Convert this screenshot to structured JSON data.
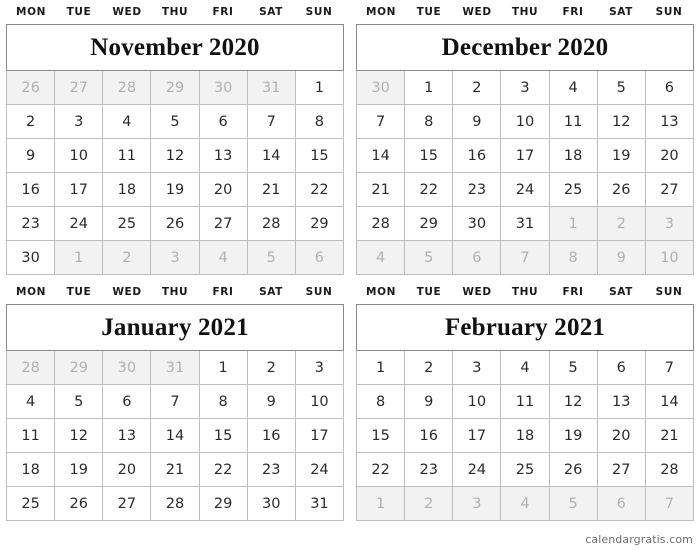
{
  "weekday_headers": [
    "MON",
    "TUE",
    "WED",
    "THU",
    "FRI",
    "SAT",
    "SUN"
  ],
  "footer": {
    "credit": "calendargratis.com"
  },
  "colors": {
    "page_background": "#ffffff",
    "cell_background": "#ffffff",
    "muted_cell_background": "#f2f2f2",
    "muted_text": "#b1b1b1",
    "text": "#2b2b2b",
    "outer_border": "#8a8a8a",
    "inner_border": "#bdbdbd",
    "footer_text": "#6d6d6d"
  },
  "calendars": [
    {
      "id": "november-2020",
      "title": "November 2020",
      "month": "November",
      "year": "2020",
      "weeks": [
        [
          {
            "d": "26",
            "muted": true
          },
          {
            "d": "27",
            "muted": true
          },
          {
            "d": "28",
            "muted": true
          },
          {
            "d": "29",
            "muted": true
          },
          {
            "d": "30",
            "muted": true
          },
          {
            "d": "31",
            "muted": true
          },
          {
            "d": "1",
            "muted": false
          }
        ],
        [
          {
            "d": "2",
            "muted": false
          },
          {
            "d": "3",
            "muted": false
          },
          {
            "d": "4",
            "muted": false
          },
          {
            "d": "5",
            "muted": false
          },
          {
            "d": "6",
            "muted": false
          },
          {
            "d": "7",
            "muted": false
          },
          {
            "d": "8",
            "muted": false
          }
        ],
        [
          {
            "d": "9",
            "muted": false
          },
          {
            "d": "10",
            "muted": false
          },
          {
            "d": "11",
            "muted": false
          },
          {
            "d": "12",
            "muted": false
          },
          {
            "d": "13",
            "muted": false
          },
          {
            "d": "14",
            "muted": false
          },
          {
            "d": "15",
            "muted": false
          }
        ],
        [
          {
            "d": "16",
            "muted": false
          },
          {
            "d": "17",
            "muted": false
          },
          {
            "d": "18",
            "muted": false
          },
          {
            "d": "19",
            "muted": false
          },
          {
            "d": "20",
            "muted": false
          },
          {
            "d": "21",
            "muted": false
          },
          {
            "d": "22",
            "muted": false
          }
        ],
        [
          {
            "d": "23",
            "muted": false
          },
          {
            "d": "24",
            "muted": false
          },
          {
            "d": "25",
            "muted": false
          },
          {
            "d": "26",
            "muted": false
          },
          {
            "d": "27",
            "muted": false
          },
          {
            "d": "28",
            "muted": false
          },
          {
            "d": "29",
            "muted": false
          }
        ],
        [
          {
            "d": "30",
            "muted": false
          },
          {
            "d": "1",
            "muted": true
          },
          {
            "d": "2",
            "muted": true
          },
          {
            "d": "3",
            "muted": true
          },
          {
            "d": "4",
            "muted": true
          },
          {
            "d": "5",
            "muted": true
          },
          {
            "d": "6",
            "muted": true
          }
        ]
      ]
    },
    {
      "id": "december-2020",
      "title": "December 2020",
      "month": "December",
      "year": "2020",
      "weeks": [
        [
          {
            "d": "30",
            "muted": true
          },
          {
            "d": "1",
            "muted": false
          },
          {
            "d": "2",
            "muted": false
          },
          {
            "d": "3",
            "muted": false
          },
          {
            "d": "4",
            "muted": false
          },
          {
            "d": "5",
            "muted": false
          },
          {
            "d": "6",
            "muted": false
          }
        ],
        [
          {
            "d": "7",
            "muted": false
          },
          {
            "d": "8",
            "muted": false
          },
          {
            "d": "9",
            "muted": false
          },
          {
            "d": "10",
            "muted": false
          },
          {
            "d": "11",
            "muted": false
          },
          {
            "d": "12",
            "muted": false
          },
          {
            "d": "13",
            "muted": false
          }
        ],
        [
          {
            "d": "14",
            "muted": false
          },
          {
            "d": "15",
            "muted": false
          },
          {
            "d": "16",
            "muted": false
          },
          {
            "d": "17",
            "muted": false
          },
          {
            "d": "18",
            "muted": false
          },
          {
            "d": "19",
            "muted": false
          },
          {
            "d": "20",
            "muted": false
          }
        ],
        [
          {
            "d": "21",
            "muted": false
          },
          {
            "d": "22",
            "muted": false
          },
          {
            "d": "23",
            "muted": false
          },
          {
            "d": "24",
            "muted": false
          },
          {
            "d": "25",
            "muted": false
          },
          {
            "d": "26",
            "muted": false
          },
          {
            "d": "27",
            "muted": false
          }
        ],
        [
          {
            "d": "28",
            "muted": false
          },
          {
            "d": "29",
            "muted": false
          },
          {
            "d": "30",
            "muted": false
          },
          {
            "d": "31",
            "muted": false
          },
          {
            "d": "1",
            "muted": true
          },
          {
            "d": "2",
            "muted": true
          },
          {
            "d": "3",
            "muted": true
          }
        ],
        [
          {
            "d": "4",
            "muted": true
          },
          {
            "d": "5",
            "muted": true
          },
          {
            "d": "6",
            "muted": true
          },
          {
            "d": "7",
            "muted": true
          },
          {
            "d": "8",
            "muted": true
          },
          {
            "d": "9",
            "muted": true
          },
          {
            "d": "10",
            "muted": true
          }
        ]
      ]
    },
    {
      "id": "january-2021",
      "title": "January 2021",
      "month": "January",
      "year": "2021",
      "weeks": [
        [
          {
            "d": "28",
            "muted": true
          },
          {
            "d": "29",
            "muted": true
          },
          {
            "d": "30",
            "muted": true
          },
          {
            "d": "31",
            "muted": true
          },
          {
            "d": "1",
            "muted": false
          },
          {
            "d": "2",
            "muted": false
          },
          {
            "d": "3",
            "muted": false
          }
        ],
        [
          {
            "d": "4",
            "muted": false
          },
          {
            "d": "5",
            "muted": false
          },
          {
            "d": "6",
            "muted": false
          },
          {
            "d": "7",
            "muted": false
          },
          {
            "d": "8",
            "muted": false
          },
          {
            "d": "9",
            "muted": false
          },
          {
            "d": "10",
            "muted": false
          }
        ],
        [
          {
            "d": "11",
            "muted": false
          },
          {
            "d": "12",
            "muted": false
          },
          {
            "d": "13",
            "muted": false
          },
          {
            "d": "14",
            "muted": false
          },
          {
            "d": "15",
            "muted": false
          },
          {
            "d": "16",
            "muted": false
          },
          {
            "d": "17",
            "muted": false
          }
        ],
        [
          {
            "d": "18",
            "muted": false
          },
          {
            "d": "19",
            "muted": false
          },
          {
            "d": "20",
            "muted": false
          },
          {
            "d": "21",
            "muted": false
          },
          {
            "d": "22",
            "muted": false
          },
          {
            "d": "23",
            "muted": false
          },
          {
            "d": "24",
            "muted": false
          }
        ],
        [
          {
            "d": "25",
            "muted": false
          },
          {
            "d": "26",
            "muted": false
          },
          {
            "d": "27",
            "muted": false
          },
          {
            "d": "28",
            "muted": false
          },
          {
            "d": "29",
            "muted": false
          },
          {
            "d": "30",
            "muted": false
          },
          {
            "d": "31",
            "muted": false
          }
        ]
      ]
    },
    {
      "id": "february-2021",
      "title": "February 2021",
      "month": "February",
      "year": "2021",
      "weeks": [
        [
          {
            "d": "1",
            "muted": false
          },
          {
            "d": "2",
            "muted": false
          },
          {
            "d": "3",
            "muted": false
          },
          {
            "d": "4",
            "muted": false
          },
          {
            "d": "5",
            "muted": false
          },
          {
            "d": "6",
            "muted": false
          },
          {
            "d": "7",
            "muted": false
          }
        ],
        [
          {
            "d": "8",
            "muted": false
          },
          {
            "d": "9",
            "muted": false
          },
          {
            "d": "10",
            "muted": false
          },
          {
            "d": "11",
            "muted": false
          },
          {
            "d": "12",
            "muted": false
          },
          {
            "d": "13",
            "muted": false
          },
          {
            "d": "14",
            "muted": false
          }
        ],
        [
          {
            "d": "15",
            "muted": false
          },
          {
            "d": "16",
            "muted": false
          },
          {
            "d": "17",
            "muted": false
          },
          {
            "d": "18",
            "muted": false
          },
          {
            "d": "19",
            "muted": false
          },
          {
            "d": "20",
            "muted": false
          },
          {
            "d": "21",
            "muted": false
          }
        ],
        [
          {
            "d": "22",
            "muted": false
          },
          {
            "d": "23",
            "muted": false
          },
          {
            "d": "24",
            "muted": false
          },
          {
            "d": "25",
            "muted": false
          },
          {
            "d": "26",
            "muted": false
          },
          {
            "d": "27",
            "muted": false
          },
          {
            "d": "28",
            "muted": false
          }
        ],
        [
          {
            "d": "1",
            "muted": true
          },
          {
            "d": "2",
            "muted": true
          },
          {
            "d": "3",
            "muted": true
          },
          {
            "d": "4",
            "muted": true
          },
          {
            "d": "5",
            "muted": true
          },
          {
            "d": "6",
            "muted": true
          },
          {
            "d": "7",
            "muted": true
          }
        ]
      ]
    }
  ]
}
